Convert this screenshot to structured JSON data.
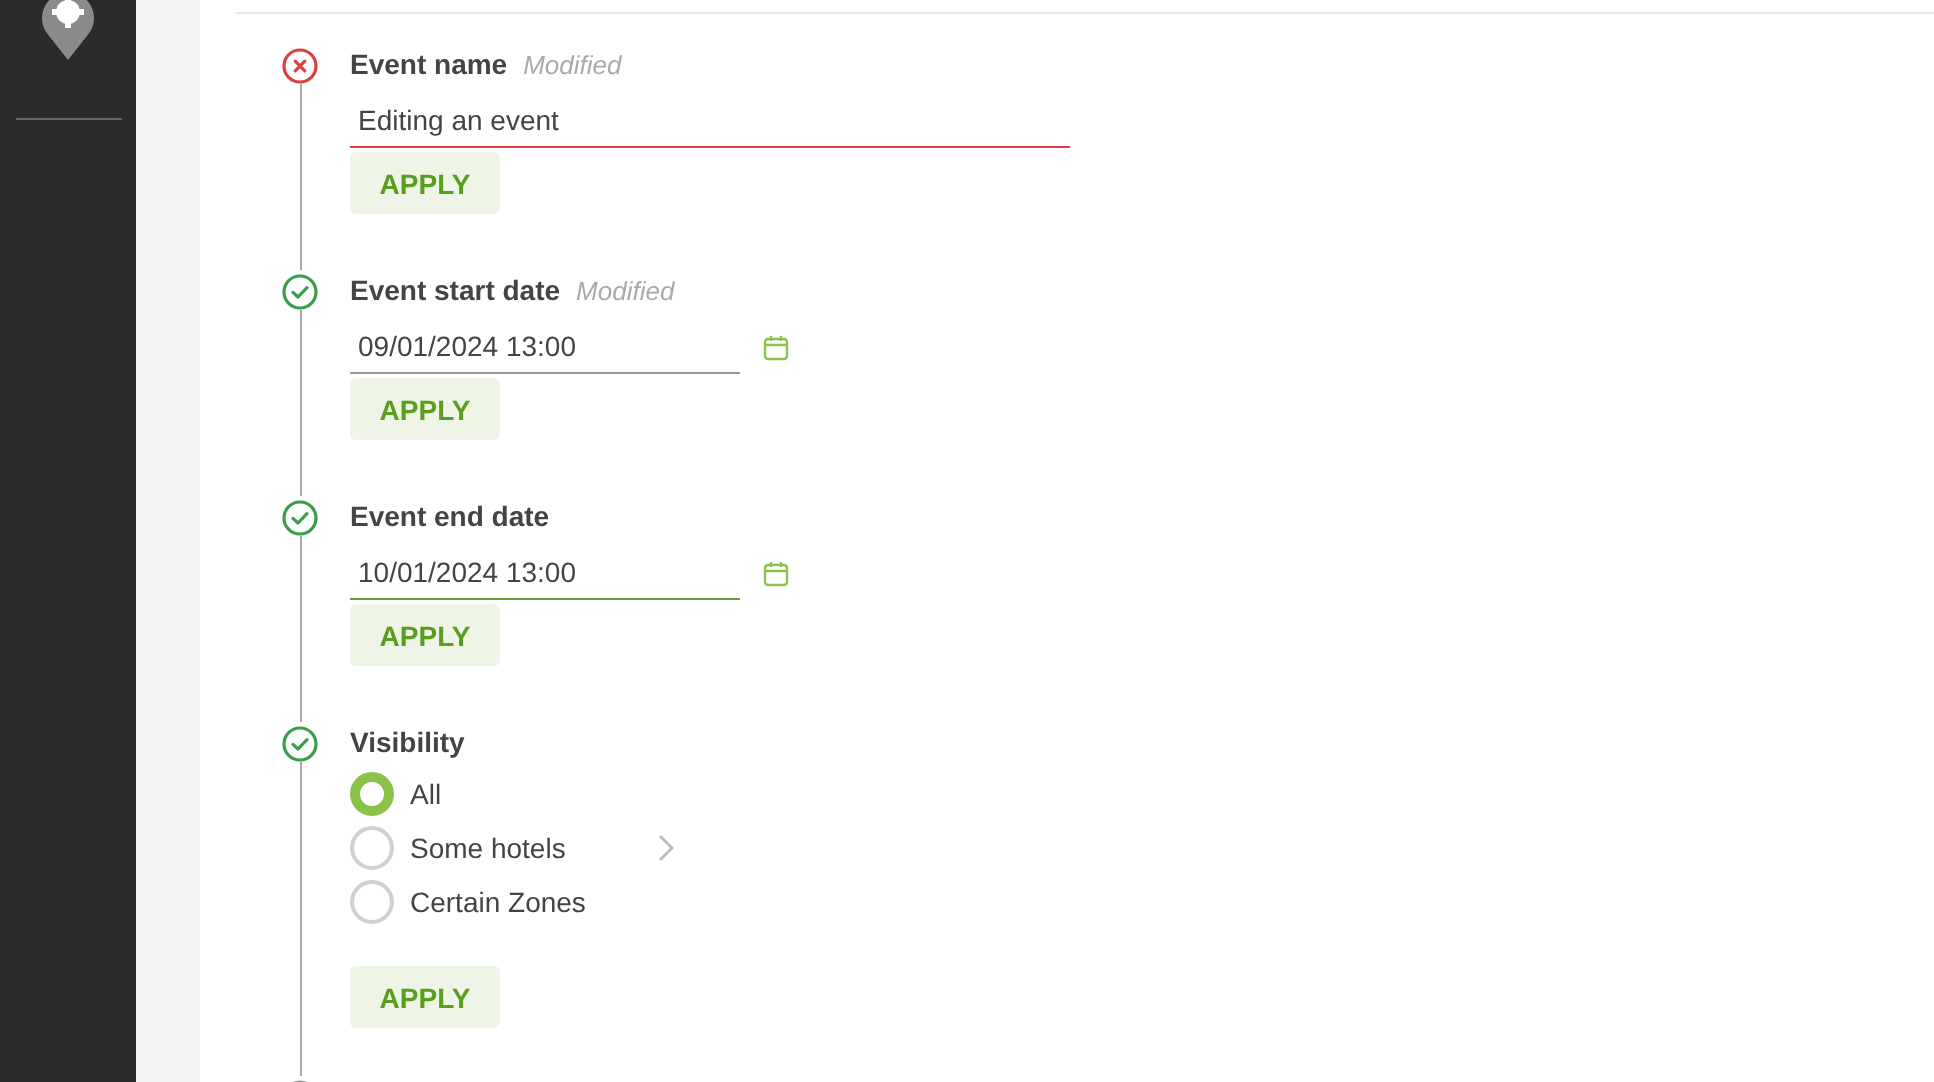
{
  "steps": [
    {
      "kind": "text",
      "valid": false,
      "label": "Event name",
      "note": "Modified",
      "value": "Editing an event",
      "button": "APPLY"
    },
    {
      "kind": "date",
      "valid": true,
      "label": "Event start date",
      "note": "Modified",
      "value": "09/01/2024 13:00",
      "focused": false,
      "button": "APPLY"
    },
    {
      "kind": "date",
      "valid": true,
      "label": "Event end date",
      "value": "10/01/2024 13:00",
      "focused": true,
      "button": "APPLY"
    },
    {
      "kind": "radio",
      "valid": true,
      "label": "Visibility",
      "options": [
        {
          "label": "All",
          "selected": true,
          "expandable": false
        },
        {
          "label": "Some hotels",
          "selected": false,
          "expandable": true
        },
        {
          "label": "Certain Zones",
          "selected": false,
          "expandable": false
        }
      ],
      "button": "APPLY"
    },
    {
      "kind": "pending"
    }
  ]
}
